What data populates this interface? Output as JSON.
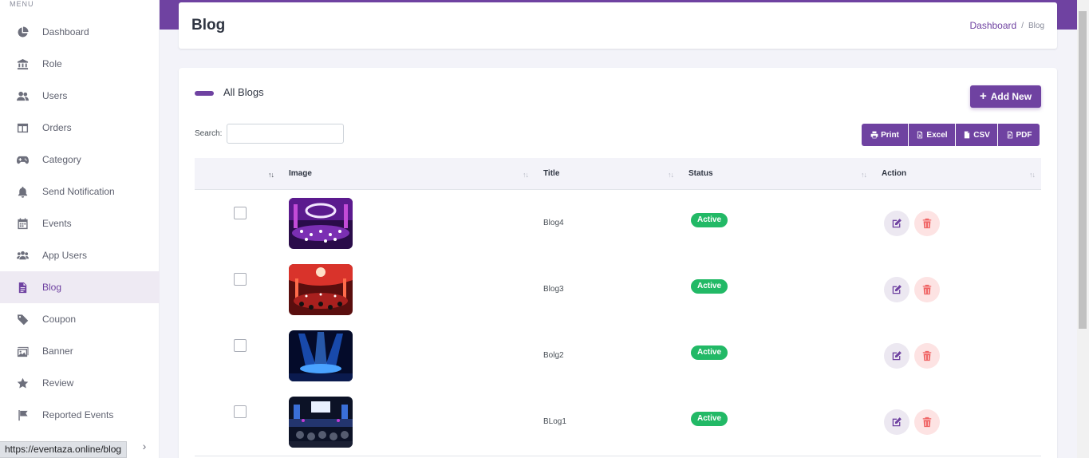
{
  "sidebar": {
    "menu_title": "MENU",
    "items": [
      {
        "label": "Dashboard",
        "icon": "pie-chart-icon"
      },
      {
        "label": "Role",
        "icon": "bank-icon"
      },
      {
        "label": "Users",
        "icon": "users-icon"
      },
      {
        "label": "Orders",
        "icon": "layout-columns-icon"
      },
      {
        "label": "Category",
        "icon": "gamepad-icon"
      },
      {
        "label": "Send Notification",
        "icon": "bell-icon"
      },
      {
        "label": "Events",
        "icon": "calendar-icon"
      },
      {
        "label": "App Users",
        "icon": "user-group-icon"
      },
      {
        "label": "Blog",
        "icon": "file-text-icon",
        "active": true
      },
      {
        "label": "Coupon",
        "icon": "tag-icon"
      },
      {
        "label": "Banner",
        "icon": "image-icon"
      },
      {
        "label": "Review",
        "icon": "star-icon"
      },
      {
        "label": "Reported Events",
        "icon": "flag-icon"
      }
    ],
    "collapse_icon": "chevron-right-icon"
  },
  "status_bar": {
    "url": "https://eventaza.online/blog"
  },
  "header": {
    "title": "Blog",
    "breadcrumb": {
      "link": "Dashboard",
      "separator": "/",
      "current": "Blog"
    }
  },
  "card": {
    "title": "All Blogs",
    "add_button": "Add New",
    "search_label": "Search:",
    "search_value": "",
    "export_buttons": [
      {
        "label": "Print",
        "icon": "printer-icon"
      },
      {
        "label": "Excel",
        "icon": "file-excel-icon"
      },
      {
        "label": "CSV",
        "icon": "file-csv-icon"
      },
      {
        "label": "PDF",
        "icon": "file-pdf-icon"
      }
    ]
  },
  "table": {
    "columns": [
      "",
      "Image",
      "Title",
      "Status",
      "Action"
    ],
    "rows": [
      {
        "title": "Blog4",
        "status": "Active"
      },
      {
        "title": "Blog3",
        "status": "Active"
      },
      {
        "title": "Bolg2",
        "status": "Active"
      },
      {
        "title": "BLog1",
        "status": "Active"
      }
    ]
  },
  "colors": {
    "primary": "#6f42a1",
    "success": "#22b966",
    "danger": "#f06565",
    "background": "#f3f3f9"
  }
}
